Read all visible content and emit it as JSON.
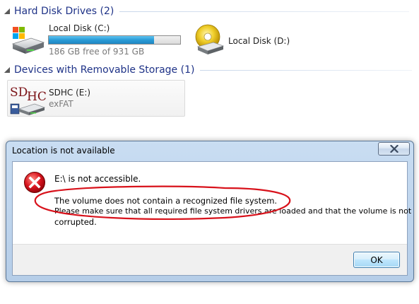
{
  "explorer": {
    "hard_disk_group": {
      "title": "Hard Disk Drives (2)"
    },
    "drives": [
      {
        "name": "Local Disk (C:)",
        "free_text": "186 GB free of 931 GB",
        "used_fraction": 0.8
      },
      {
        "name": "Local Disk (D:)"
      }
    ],
    "removable_group": {
      "title": "Devices with Removable Storage (1)"
    },
    "removable": {
      "name": "SDHC (E:)",
      "filesystem": "exFAT",
      "icon_text": {
        "part1": "SD",
        "part2": "HC"
      }
    }
  },
  "dialog": {
    "title": "Location is not available",
    "heading": "E:\\ is not accessible.",
    "detail_line1": "The volume does not contain a recognized file system.",
    "detail_line2": "Please make sure that all required file system drivers are loaded and that the volume is not",
    "detail_line3": "corrupted.",
    "ok_label": "OK"
  },
  "colors": {
    "group_title": "#1e3287",
    "annotation_circle": "#d8121b",
    "error_icon": "#c8141e"
  },
  "icons": {
    "group_toggle": "collapse-arrow-icon",
    "drive_c": "windows-hard-drive-icon",
    "drive_d": "hard-drive-icon",
    "removable": "sd-card-drive-icon",
    "error": "error-icon",
    "close": "close-icon"
  }
}
